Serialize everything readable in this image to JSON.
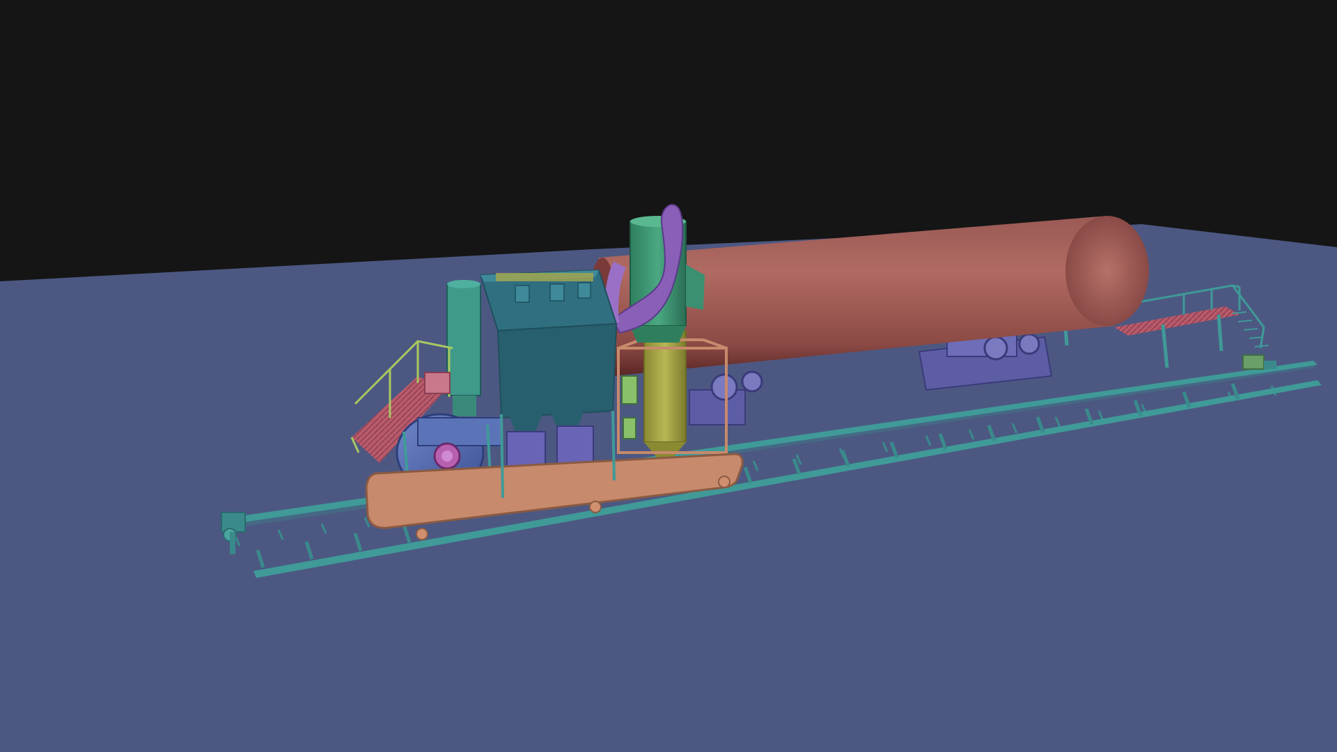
{
  "viewport": {
    "view_mode": "perspective",
    "shading": "solid-colored"
  },
  "scene": {
    "objects": [
      {
        "name": "rotary-drum",
        "color": "#a86560"
      },
      {
        "name": "dust-collector",
        "color": "#2f6f80"
      },
      {
        "name": "cyclone-separator",
        "color": "#3f9a7a"
      },
      {
        "name": "burner-tower",
        "color": "#a8a64a"
      },
      {
        "name": "duct-pipe",
        "color": "#8a5fb8"
      },
      {
        "name": "blower-fan",
        "color": "#5b74b8"
      },
      {
        "name": "trailer-chassis",
        "color": "#c78a6c"
      },
      {
        "name": "rail-track",
        "color": "#3a8a8c"
      },
      {
        "name": "drive-rollers",
        "color": "#6a6ab0"
      },
      {
        "name": "work-platform",
        "color": "#c9778a"
      },
      {
        "name": "safety-railings",
        "color": "#a8c860"
      },
      {
        "name": "ground-plane",
        "color": "#4c5882"
      },
      {
        "name": "background",
        "color": "#151515"
      }
    ]
  }
}
